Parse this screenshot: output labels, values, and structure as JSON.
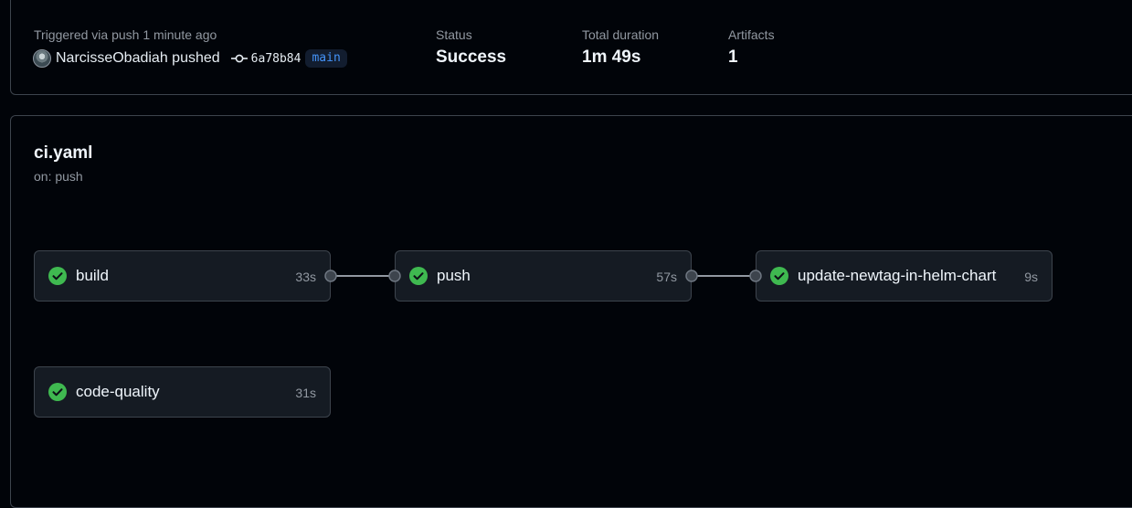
{
  "summary": {
    "trigger_label": "Triggered via push 1 minute ago",
    "actor_text": "NarcisseObadiah pushed",
    "commit_sha": "6a78b84",
    "branch": "main",
    "status_label": "Status",
    "status_value": "Success",
    "duration_label": "Total duration",
    "duration_value": "1m 49s",
    "artifacts_label": "Artifacts",
    "artifacts_value": "1"
  },
  "workflow": {
    "title": "ci.yaml",
    "trigger": "on: push",
    "jobs": [
      {
        "name": "build",
        "duration": "33s",
        "status": "success"
      },
      {
        "name": "push",
        "duration": "57s",
        "status": "success"
      },
      {
        "name": "update-newtag-in-helm-chart",
        "duration": "9s",
        "status": "success"
      },
      {
        "name": "code-quality",
        "duration": "31s",
        "status": "success"
      }
    ]
  },
  "colors": {
    "background": "#010409",
    "card_border": "#3d444d",
    "job_background": "#151b23",
    "success": "#3fb950",
    "branch_text": "#4493f8",
    "muted_text": "#9198a1"
  },
  "icons": {
    "commit": "git-commit-icon",
    "status": "check-circle-fill-icon"
  }
}
